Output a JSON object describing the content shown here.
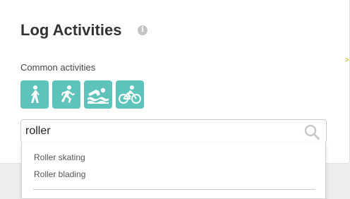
{
  "card": {
    "title": "Log Activities",
    "info_icon": "i"
  },
  "common_activities": {
    "label": "Common activities",
    "items": [
      {
        "icon": "walking-icon"
      },
      {
        "icon": "running-icon"
      },
      {
        "icon": "swimming-icon"
      },
      {
        "icon": "cycling-icon"
      }
    ]
  },
  "search": {
    "value": "roller",
    "icon": "search-icon"
  },
  "suggestions": [
    "Roller skating",
    "Roller blading"
  ],
  "side_mark": ">",
  "colors": {
    "activity_button": "#5ec4bb",
    "title": "#333333",
    "info_icon": "#c4c4c4"
  }
}
